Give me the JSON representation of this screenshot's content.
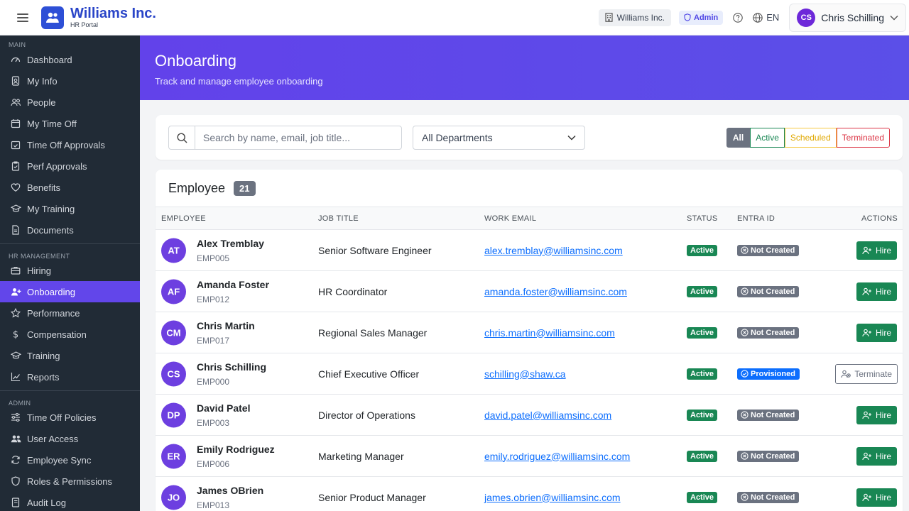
{
  "header": {
    "brand_name": "Williams Inc.",
    "brand_sub": "HR Portal",
    "company": "Williams Inc.",
    "role": "Admin",
    "language": "EN",
    "user_initials": "CS",
    "user_name": "Chris Schilling"
  },
  "sidebar": {
    "sections": [
      {
        "label": "MAIN",
        "items": [
          {
            "label": "Dashboard",
            "icon": "speedometer-icon"
          },
          {
            "label": "My Info",
            "icon": "person-badge-icon"
          },
          {
            "label": "People",
            "icon": "people-icon"
          },
          {
            "label": "My Time Off",
            "icon": "calendar-icon"
          },
          {
            "label": "Time Off Approvals",
            "icon": "calendar-check-icon"
          },
          {
            "label": "Perf Approvals",
            "icon": "clipboard-check-icon"
          },
          {
            "label": "Benefits",
            "icon": "heart-icon"
          },
          {
            "label": "My Training",
            "icon": "mortarboard-icon"
          },
          {
            "label": "Documents",
            "icon": "document-icon"
          }
        ]
      },
      {
        "label": "HR MANAGEMENT",
        "items": [
          {
            "label": "Hiring",
            "icon": "briefcase-icon"
          },
          {
            "label": "Onboarding",
            "icon": "person-plus-icon",
            "active": true
          },
          {
            "label": "Performance",
            "icon": "star-icon"
          },
          {
            "label": "Compensation",
            "icon": "dollar-icon"
          },
          {
            "label": "Training",
            "icon": "mortarboard-icon"
          },
          {
            "label": "Reports",
            "icon": "chart-line-icon"
          }
        ]
      },
      {
        "label": "ADMIN",
        "items": [
          {
            "label": "Time Off Policies",
            "icon": "sliders-icon"
          },
          {
            "label": "User Access",
            "icon": "people-fill-icon"
          },
          {
            "label": "Employee Sync",
            "icon": "sync-icon"
          },
          {
            "label": "Roles & Permissions",
            "icon": "shield-icon"
          },
          {
            "label": "Audit Log",
            "icon": "journal-icon"
          }
        ]
      }
    ]
  },
  "page": {
    "title": "Onboarding",
    "subtitle": "Track and manage employee onboarding"
  },
  "filters": {
    "search_placeholder": "Search by name, email, job title...",
    "department": "All Departments",
    "segments": [
      "All",
      "Active",
      "Scheduled",
      "Terminated"
    ]
  },
  "table": {
    "title": "Employee",
    "count": "21",
    "columns": [
      "EMPLOYEE",
      "JOB TITLE",
      "WORK EMAIL",
      "STATUS",
      "ENTRA ID",
      "ACTIONS"
    ],
    "rows": [
      {
        "initials": "AT",
        "name": "Alex Tremblay",
        "id": "EMP005",
        "job": "Senior Software Engineer",
        "email": "alex.tremblay@williamsinc.com",
        "status": "Active",
        "entra": "Not Created",
        "action": "Hire"
      },
      {
        "initials": "AF",
        "name": "Amanda Foster",
        "id": "EMP012",
        "job": "HR Coordinator",
        "email": "amanda.foster@williamsinc.com",
        "status": "Active",
        "entra": "Not Created",
        "action": "Hire"
      },
      {
        "initials": "CM",
        "name": "Chris Martin",
        "id": "EMP017",
        "job": "Regional Sales Manager",
        "email": "chris.martin@williamsinc.com",
        "status": "Active",
        "entra": "Not Created",
        "action": "Hire"
      },
      {
        "initials": "CS",
        "name": "Chris Schilling",
        "id": "EMP000",
        "job": "Chief Executive Officer",
        "email": "schilling@shaw.ca",
        "status": "Active",
        "entra": "Provisioned",
        "action": "Terminate"
      },
      {
        "initials": "DP",
        "name": "David Patel",
        "id": "EMP003",
        "job": "Director of Operations",
        "email": "david.patel@williamsinc.com",
        "status": "Active",
        "entra": "Not Created",
        "action": "Hire"
      },
      {
        "initials": "ER",
        "name": "Emily Rodriguez",
        "id": "EMP006",
        "job": "Marketing Manager",
        "email": "emily.rodriguez@williamsinc.com",
        "status": "Active",
        "entra": "Not Created",
        "action": "Hire"
      },
      {
        "initials": "JO",
        "name": "James OBrien",
        "id": "EMP013",
        "job": "Senior Product Manager",
        "email": "james.obrien@williamsinc.com",
        "status": "Active",
        "entra": "Not Created",
        "action": "Hire"
      }
    ]
  }
}
